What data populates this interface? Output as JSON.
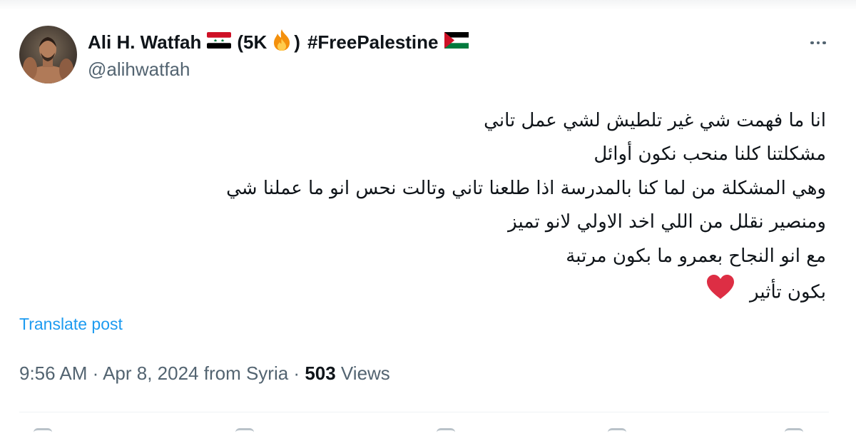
{
  "author": {
    "display_name": "Ali H. Watfah",
    "followers_badge_open": "(5K",
    "followers_badge_close": ")",
    "hashtag": "#FreePalestine",
    "handle": "@alihwatfah"
  },
  "tweet": {
    "lines": [
      "انا ما فهمت شي غير تلطيش لشي عمل تاني",
      "مشكلتنا كلنا منحب نكون أوائل",
      "وهي المشكلة من لما كنا بالمدرسة اذا طلعنا تاني وتالت نحس انو ما عملنا شي",
      "ومنصير نقلل من اللي اخد الاولي لانو تميز",
      "مع انو النجاح بعمرو ما بكون مرتبة",
      "بكون تأثير"
    ]
  },
  "actions": {
    "translate_label": "Translate post"
  },
  "meta": {
    "time": "9:56 AM",
    "sep1": " · ",
    "date": "Apr 8, 2024",
    "location_text": " from Syria",
    "sep2": " · ",
    "views_count": "503",
    "views_label": " Views"
  },
  "colors": {
    "link": "#1d9bf0",
    "secondary_text": "#536471",
    "primary_text": "#0f1419",
    "heart": "#e0245e"
  },
  "icons": {
    "more": "more-options-icon",
    "flag_syria": "syria-flag-icon",
    "flag_palestine": "palestine-flag-icon",
    "fire": "fire-emoji-icon",
    "heart": "red-heart-emoji-icon"
  }
}
